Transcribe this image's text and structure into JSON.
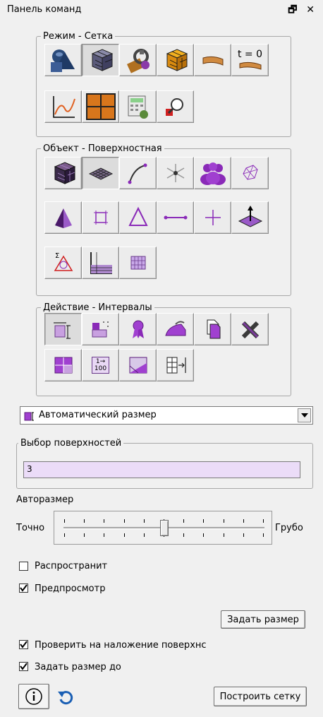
{
  "panel": {
    "title": "Панель команд",
    "float_label": "🗗",
    "close_label": "✕"
  },
  "groups": {
    "mode": {
      "legend": "Режим - Сетка",
      "buttons": [
        {
          "icon": "geometry-shapes-icon"
        },
        {
          "icon": "mesh-cube-icon",
          "active": true
        },
        {
          "icon": "tools-icon"
        },
        {
          "icon": "yellow-mesh-cube-icon"
        },
        {
          "icon": "boundary-strip-icon"
        },
        {
          "icon": "time-zero-icon",
          "text": "t = 0"
        },
        {
          "icon": "graph-icon"
        },
        {
          "icon": "orange-grid-icon"
        },
        {
          "icon": "calculator-icon"
        },
        {
          "icon": "magnifier-icon"
        }
      ]
    },
    "object": {
      "legend": "Объект - Поверхностная",
      "buttons": [
        {
          "icon": "volume-mesh-icon"
        },
        {
          "icon": "surface-mesh-icon",
          "active": true
        },
        {
          "icon": "curve-icon"
        },
        {
          "icon": "vertex-star-icon"
        },
        {
          "icon": "group-icon"
        },
        {
          "icon": "wire-cube-icon"
        },
        {
          "icon": "pyramid-icon"
        },
        {
          "icon": "square-node-icon"
        },
        {
          "icon": "triangle-icon"
        },
        {
          "icon": "edge-line-icon"
        },
        {
          "icon": "cross-node-icon"
        },
        {
          "icon": "normal-vector-icon"
        },
        {
          "icon": "sigma-node-icon"
        },
        {
          "icon": "boundary-layer-icon"
        },
        {
          "icon": "grid-block-icon"
        }
      ]
    },
    "action": {
      "legend": "Действие - Интервалы",
      "buttons": [
        {
          "icon": "interval-size-icon",
          "active": true
        },
        {
          "icon": "interval-dots-icon"
        },
        {
          "icon": "ribbon-icon"
        },
        {
          "icon": "iron-icon"
        },
        {
          "icon": "copy-icon"
        },
        {
          "icon": "delete-x-icon"
        },
        {
          "icon": "quad-split-icon"
        },
        {
          "icon": "count-100-icon",
          "text": "1→\n100"
        },
        {
          "icon": "gradient-ramp-icon"
        },
        {
          "icon": "grid-arrow-icon"
        }
      ]
    }
  },
  "dropdown": {
    "value": "Автоматический размер"
  },
  "surface_select": {
    "legend": "Выбор поверхностей",
    "value": "3"
  },
  "autosize": {
    "label": "Авторазмер",
    "left_label": "Точно",
    "right_label": "Грубо",
    "slider_level": 0.5
  },
  "options": {
    "propagate": {
      "label": "Распространит",
      "checked": false
    },
    "preview": {
      "label": "Предпросмотр",
      "checked": true
    },
    "check_overlap": {
      "label": "Проверить на наложение поверхнс",
      "checked": true
    },
    "set_size_to": {
      "label": "Задать размер до",
      "checked": true
    }
  },
  "buttons": {
    "set_size": "Задать размер",
    "build_mesh": "Построить сетку"
  },
  "colors": {
    "accent_purple": "#9b2fb5",
    "input_bg": "#ebdcf8"
  }
}
